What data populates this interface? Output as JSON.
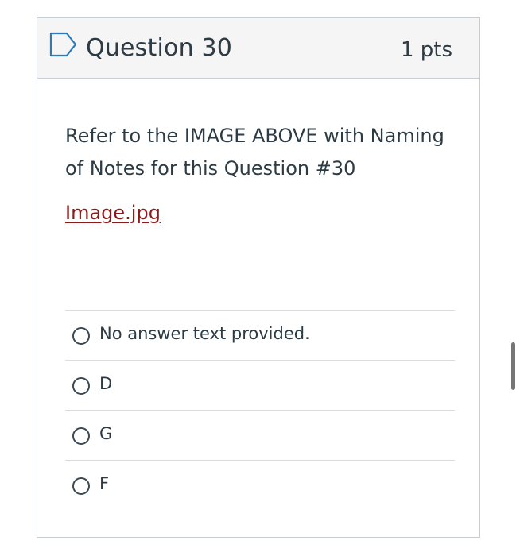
{
  "question": {
    "title": "Question 30",
    "points": "1 pts",
    "flag_icon": "flag-outline-icon",
    "text": "Refer to the IMAGE ABOVE with Naming of Notes for this Question #30",
    "link_text": "Image.jpg",
    "link_color": "#8b1a1a"
  },
  "answers": [
    {
      "label": "No answer text provided."
    },
    {
      "label": "D"
    },
    {
      "label": "G"
    },
    {
      "label": "F"
    }
  ]
}
